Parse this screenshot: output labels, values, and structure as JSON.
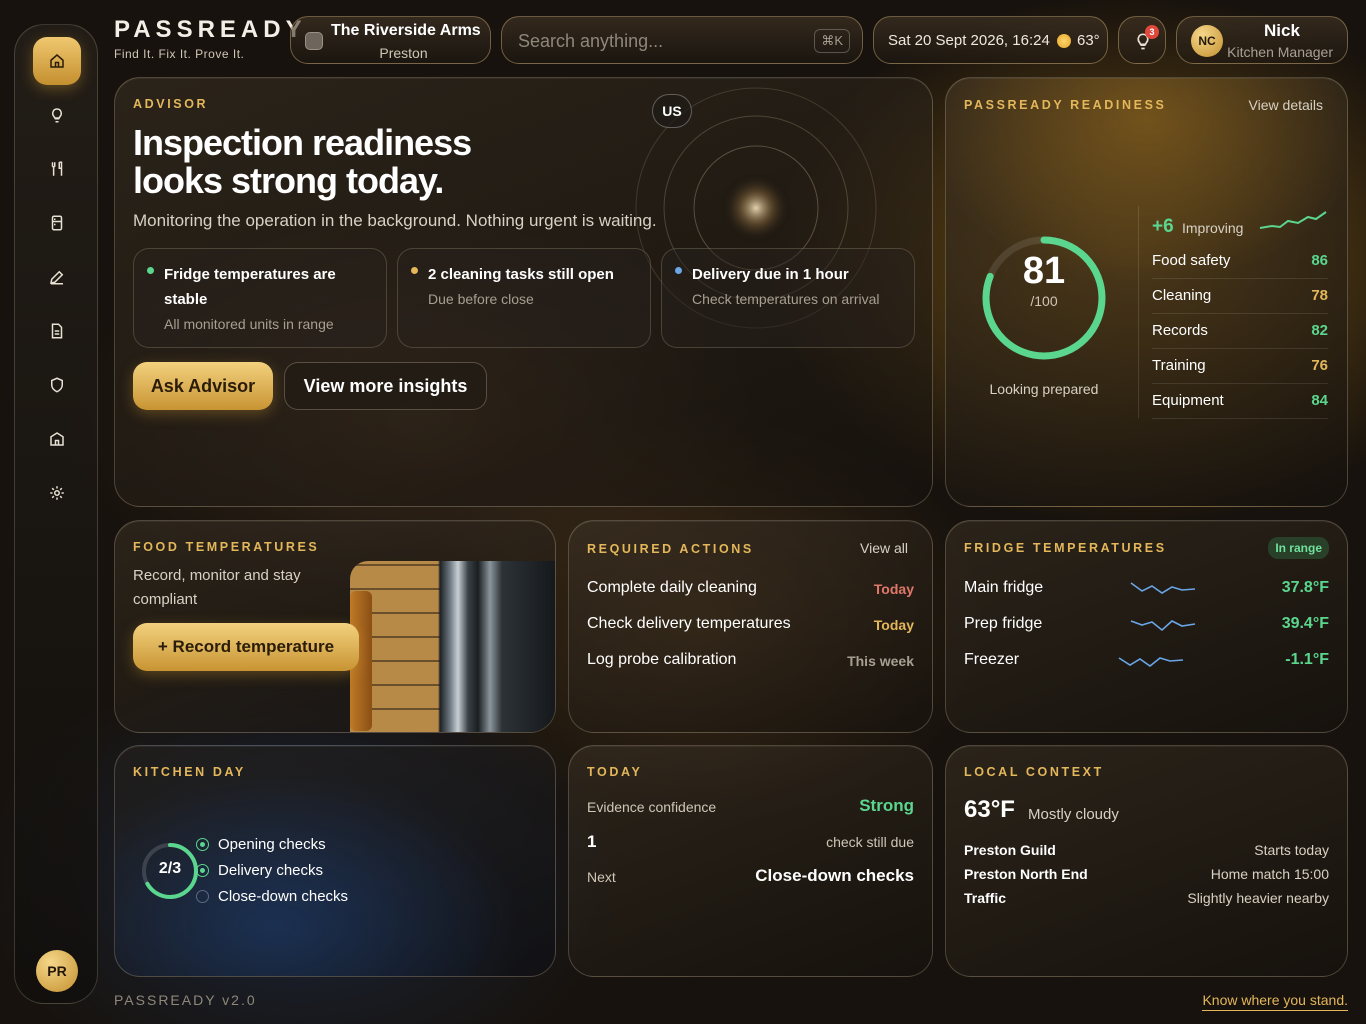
{
  "brand": {
    "name": "PASSREADY",
    "tagline": "Find It. Fix It. Prove It."
  },
  "venue": {
    "name": "The Riverside Arms",
    "location": "Preston"
  },
  "search": {
    "placeholder": "Search anything...",
    "shortcut": "⌘K"
  },
  "datetime": {
    "text": "Sat 20 Sept 2026, 16:24",
    "temperature": "63°"
  },
  "notifications": {
    "count": "3"
  },
  "user": {
    "initials": "NC",
    "name": "Nick",
    "role": "Kitchen Manager"
  },
  "sidebar": {
    "items": [
      {
        "icon": "home-icon",
        "active": true
      },
      {
        "icon": "lightbulb-icon"
      },
      {
        "icon": "utensils-icon"
      },
      {
        "icon": "fridge-icon"
      },
      {
        "icon": "pen-icon"
      },
      {
        "icon": "document-icon"
      },
      {
        "icon": "shield-icon"
      },
      {
        "icon": "building-icon"
      },
      {
        "icon": "settings-icon"
      }
    ],
    "avatar": "PR"
  },
  "advisor": {
    "label": "ADVISOR",
    "title_line1": "Inspection readiness",
    "title_line2": "looks strong today.",
    "subtitle": "Monitoring the operation in the background. Nothing urgent is waiting.",
    "us_chip": "US",
    "cards": [
      {
        "title": "Fridge temperatures are stable",
        "sub": "All monitored units in range",
        "dot": "#5bd68e"
      },
      {
        "title": "2 cleaning tasks still open",
        "sub": "Due before close",
        "dot": "#e3b75a"
      },
      {
        "title": "Delivery due in 1 hour",
        "sub": "Check temperatures on arrival",
        "dot": "#6aa6e8"
      }
    ],
    "primary_button": "Ask Advisor",
    "secondary_button": "View more insights"
  },
  "readiness": {
    "label": "PASSREADY READINESS",
    "view_details": "View details",
    "score": 81,
    "score_max": "/100",
    "caption": "Looking prepared",
    "trend_value": "+6",
    "trend_label": "Improving",
    "categories": [
      {
        "name": "Food safety",
        "value": "86",
        "color": "#5bd68e"
      },
      {
        "name": "Cleaning",
        "value": "78",
        "color": "#e3b75a"
      },
      {
        "name": "Records",
        "value": "82",
        "color": "#5bd68e"
      },
      {
        "name": "Training",
        "value": "76",
        "color": "#e3b75a"
      },
      {
        "name": "Equipment",
        "value": "84",
        "color": "#5bd68e"
      }
    ]
  },
  "food_temps": {
    "label": "FOOD TEMPERATURES",
    "description": "Record, monitor and stay compliant",
    "button": "+ Record temperature"
  },
  "required_actions": {
    "label": "REQUIRED ACTIONS",
    "view_all": "View all",
    "items": [
      {
        "name": "Complete daily cleaning",
        "due": "Today",
        "color": "#e0786a"
      },
      {
        "name": "Check delivery temperatures",
        "due": "Today",
        "color": "#e3b75a"
      },
      {
        "name": "Log probe calibration",
        "due": "This week",
        "color": "#a79f92"
      }
    ]
  },
  "fridge_temps": {
    "label": "FRIDGE TEMPERATURES",
    "status": "In range",
    "units": [
      {
        "name": "Main fridge",
        "value": "37.8°F"
      },
      {
        "name": "Prep fridge",
        "value": "39.4°F"
      },
      {
        "name": "Freezer",
        "value": "-1.1°F"
      }
    ]
  },
  "kitchen_day": {
    "label": "KITCHEN DAY",
    "progress": "2/3",
    "progress_fraction": 0.667,
    "checks": [
      {
        "name": "Opening checks",
        "done": true
      },
      {
        "name": "Delivery checks",
        "done": true
      },
      {
        "name": "Close-down checks",
        "done": false
      }
    ]
  },
  "today": {
    "label": "TODAY",
    "confidence_label": "Evidence confidence",
    "confidence_value": "Strong",
    "due_count": "1",
    "due_label": "check still due",
    "next_label": "Next",
    "next_value": "Close-down checks"
  },
  "local_context": {
    "label": "LOCAL CONTEXT",
    "temperature": "63°F",
    "condition": "Mostly cloudy",
    "items": [
      {
        "name": "Preston Guild",
        "value": "Starts today"
      },
      {
        "name": "Preston North End",
        "value": "Home match 15:00"
      },
      {
        "name": "Traffic",
        "value": "Slightly heavier nearby"
      }
    ]
  },
  "footer": {
    "version": "PASSREADY v2.0",
    "slogan": "Know where you stand."
  }
}
